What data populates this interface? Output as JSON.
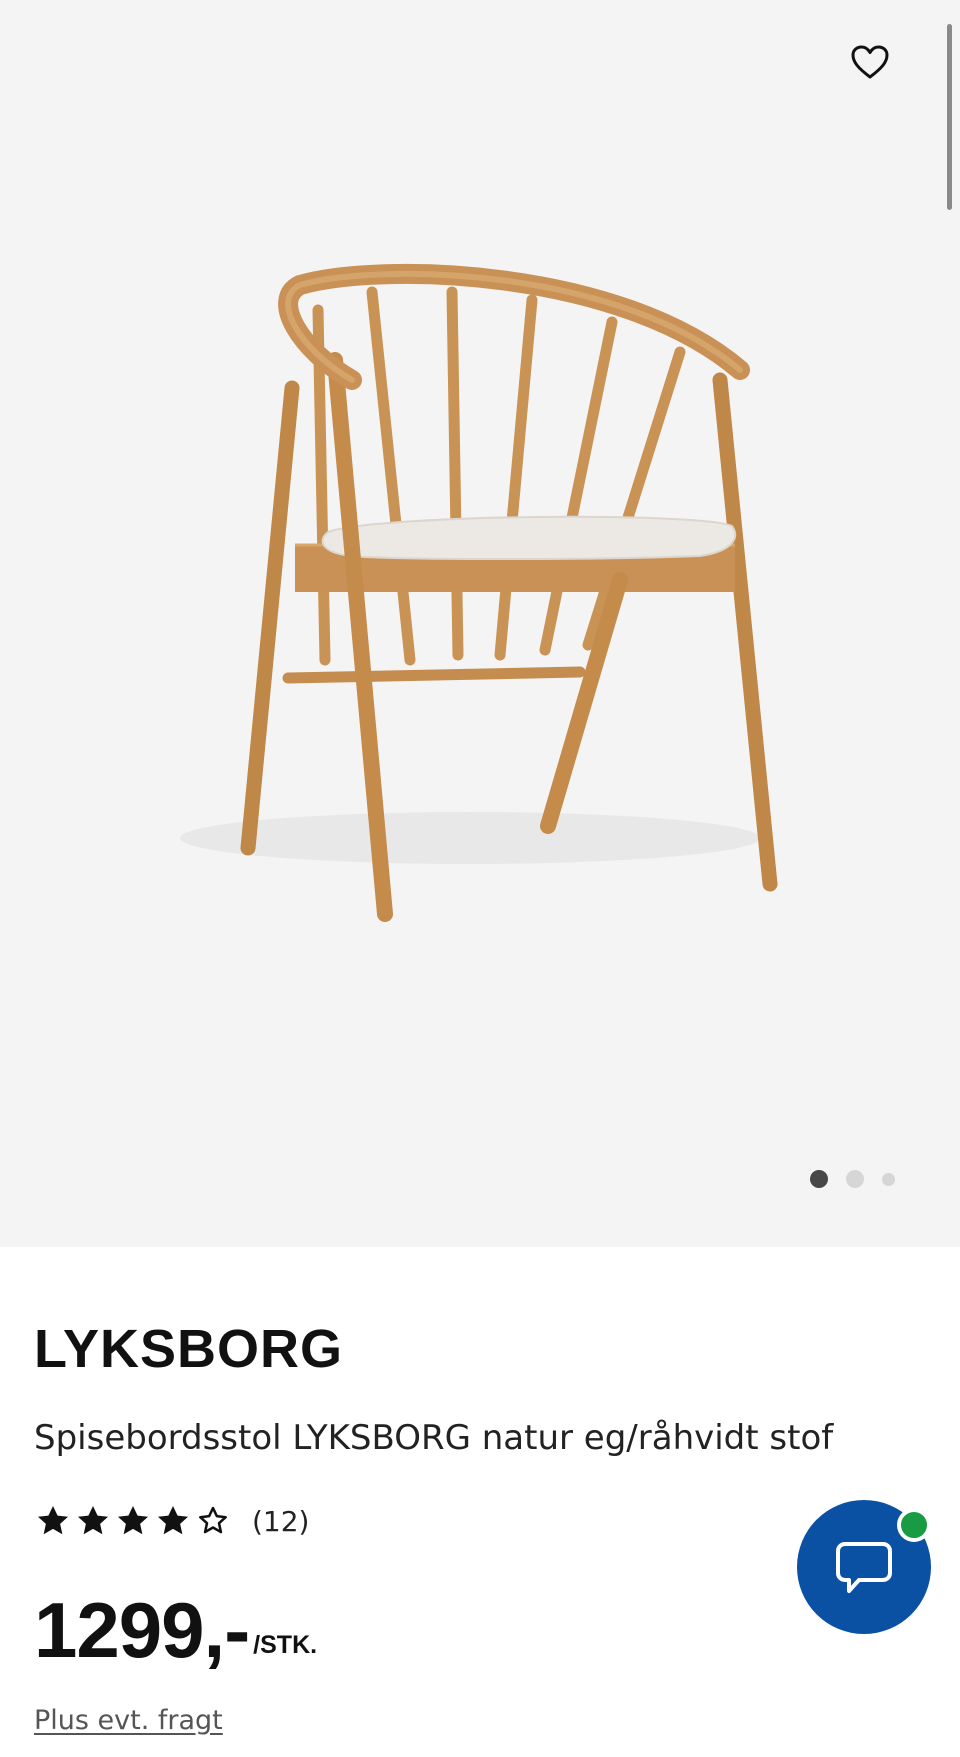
{
  "gallery": {
    "image_alt": "Spisebordsstol LYKSBORG natur eg/råhvidt stof",
    "icons": {
      "favorite": "heart-outline-icon"
    },
    "pagination": {
      "count": 3,
      "active_index": 0
    }
  },
  "product": {
    "name": "LYKSBORG",
    "description": "Spisebordsstol LYKSBORG natur eg/råhvidt stof",
    "rating": {
      "value": 4,
      "max": 5,
      "count_label": "(12)"
    },
    "price": {
      "amount": "1299,-",
      "unit": "/STK."
    },
    "freight_link": "Plus evt. fragt"
  },
  "chat": {
    "icon": "chat-bubble-icon",
    "status": "online",
    "colors": {
      "button": "#0a51a4",
      "status": "#189b43"
    }
  }
}
